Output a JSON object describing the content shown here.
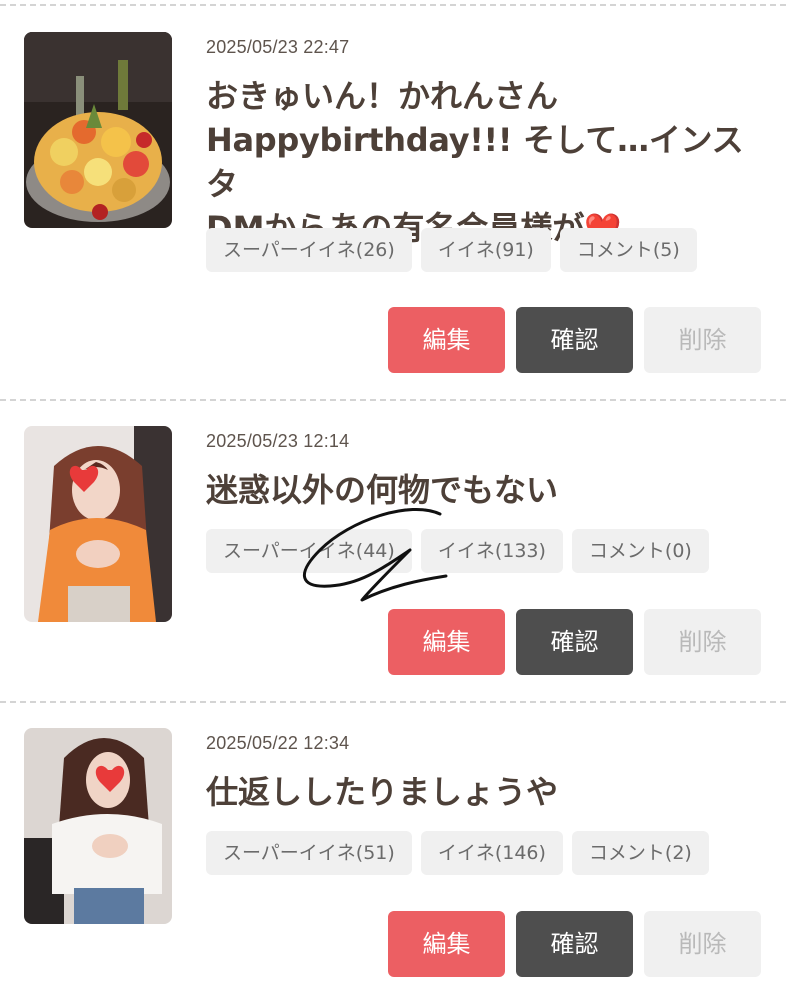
{
  "posts": [
    {
      "date": "2025/05/23 22:47",
      "title_line1": "おきゅいん！かれんさん",
      "title_line2": "Happybirthday!!! そして…インスタ",
      "title_line3": "DMからあの有名会員様が",
      "title_emoji": "❤️",
      "super_like": "スーパーイイネ(26)",
      "like": "イイネ(91)",
      "comment": "コメント(5)",
      "edit": "編集",
      "confirm": "確認",
      "delete": "削除"
    },
    {
      "date": "2025/05/23 12:14",
      "title_line1": "迷惑以外の何物でもない",
      "super_like": "スーパーイイネ(44)",
      "like": "イイネ(133)",
      "comment": "コメント(0)",
      "edit": "編集",
      "confirm": "確認",
      "delete": "削除"
    },
    {
      "date": "2025/05/22 12:34",
      "title_line1": "仕返ししたりましょうや",
      "super_like": "スーパーイイネ(51)",
      "like": "イイネ(146)",
      "comment": "コメント(2)",
      "edit": "編集",
      "confirm": "確認",
      "delete": "削除"
    }
  ],
  "colors": {
    "edit_button": "#ec5f63",
    "confirm_button": "#4e4e4e",
    "delete_button": "#f0f0f0",
    "tag_background": "#f0f0f0",
    "title_text": "#4d4038"
  }
}
